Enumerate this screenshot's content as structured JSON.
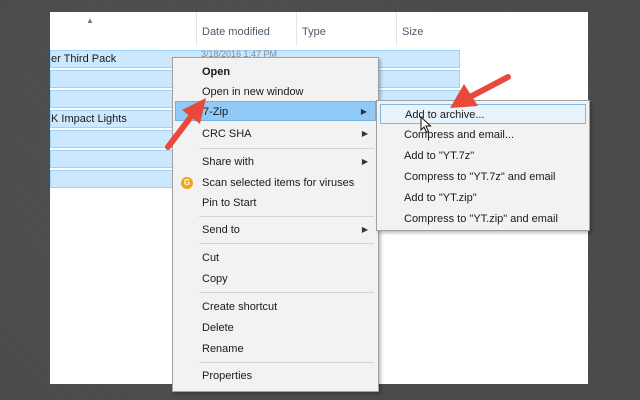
{
  "colors": {
    "selection": "#cce8ff",
    "menu_highlight": "#91c9f7",
    "annotation_arrow": "#e8493a"
  },
  "columns": {
    "date": "Date modified",
    "type": "Type",
    "size": "Size"
  },
  "files": [
    {
      "name": "er Third Pack",
      "date": "3/18/2016 1:47 PM"
    },
    {
      "name": "",
      "date": ""
    },
    {
      "name": "",
      "date": ""
    },
    {
      "name": "K Impact Lights",
      "date": ""
    },
    {
      "name": "",
      "date": ""
    },
    {
      "name": "",
      "date": ""
    },
    {
      "name": "",
      "date": ""
    }
  ],
  "context_menu": {
    "open": "Open",
    "open_new_window": "Open in new window",
    "seven_zip": "7-Zip",
    "crc_sha": "CRC SHA",
    "share_with": "Share with",
    "scan": "Scan selected items for viruses",
    "pin_start": "Pin to Start",
    "send_to": "Send to",
    "cut": "Cut",
    "copy": "Copy",
    "create_shortcut": "Create shortcut",
    "delete": "Delete",
    "rename": "Rename",
    "properties": "Properties"
  },
  "submenu": [
    "Add to archive...",
    "Compress and email...",
    "Add to \"YT.7z\"",
    "Compress to \"YT.7z\" and email",
    "Add to \"YT.zip\"",
    "Compress to \"YT.zip\" and email"
  ],
  "icons": {
    "submenu_arrow": "▶",
    "antivirus": "G",
    "sort": "▲"
  }
}
